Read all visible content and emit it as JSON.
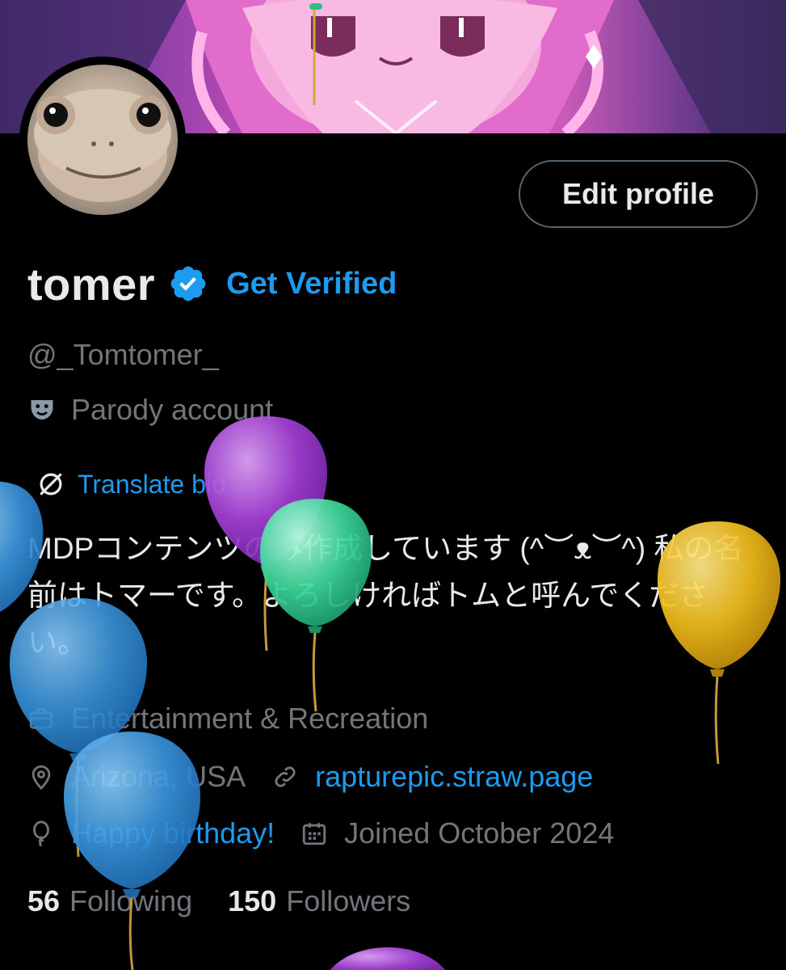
{
  "profile": {
    "display_name": "tomer",
    "get_verified_label": "Get Verified",
    "handle": "@_Tomtomer_",
    "parody_label": "Parody account",
    "translate_label": "Translate bio",
    "bio": "MDPコンテンツのみ作成しています (^︶ᴥ︶^) 私の名前はトマーです。よろしければトムと呼んでください。",
    "category": "Entertainment & Recreation",
    "location": "Arizona, USA",
    "website": "rapturepic.straw.page",
    "birthday": "Happy birthday!",
    "joined": "Joined October 2024"
  },
  "actions": {
    "edit_profile_label": "Edit profile"
  },
  "stats": {
    "following_count": "56",
    "following_label": "Following",
    "followers_count": "150",
    "followers_label": "Followers"
  },
  "icons": {
    "verified": "verified-badge-icon",
    "parody": "theater-mask-icon",
    "translate": "translate-icon",
    "category": "briefcase-icon",
    "location": "location-pin-icon",
    "link": "link-icon",
    "birthday": "balloon-icon",
    "calendar": "calendar-icon"
  },
  "colors": {
    "accent": "#1d9bf0",
    "text_primary": "#e7e9ea",
    "text_secondary": "#71767b",
    "background": "#000000",
    "border": "#536471"
  }
}
